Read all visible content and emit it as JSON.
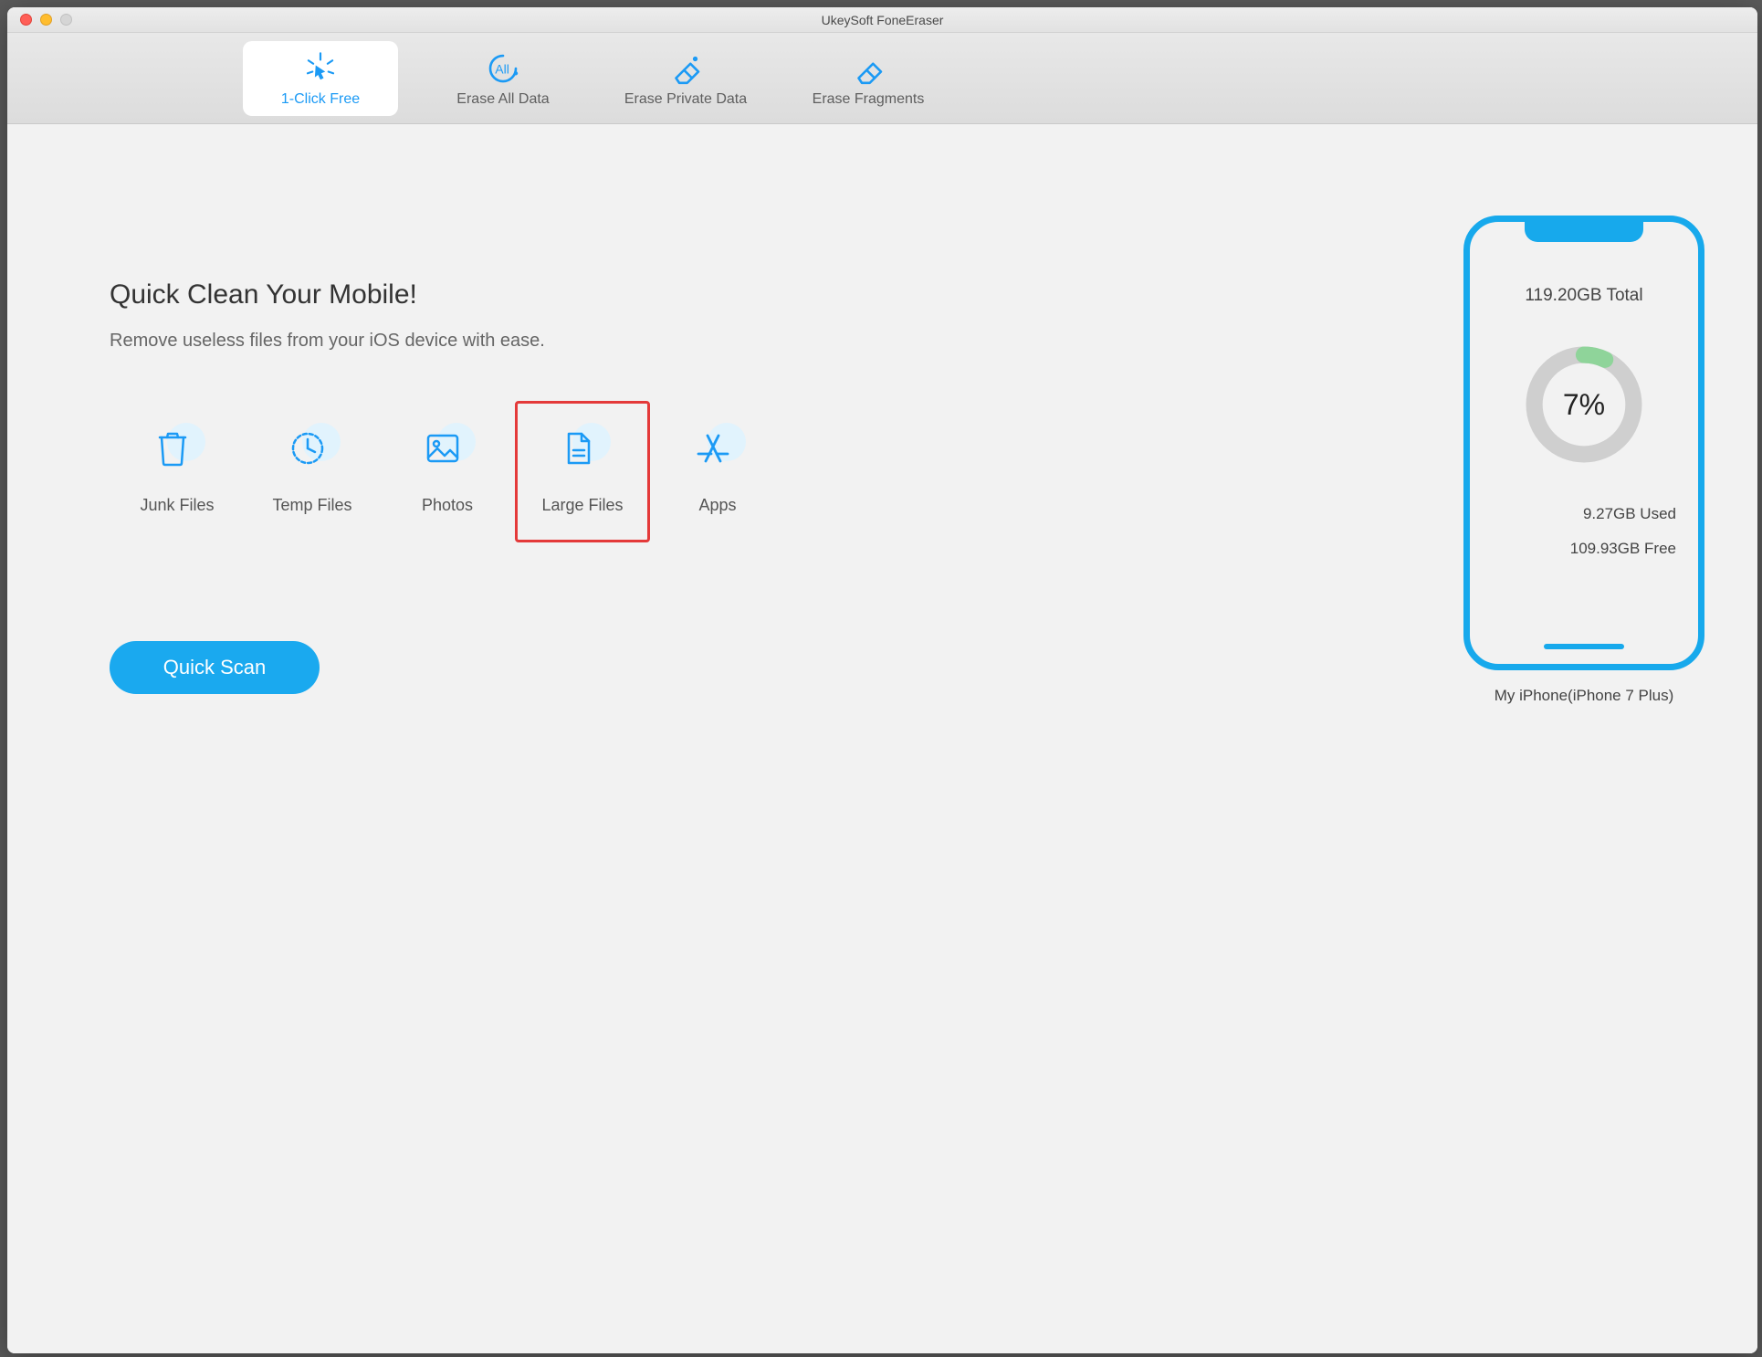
{
  "window": {
    "title": "UkeySoft FoneEraser"
  },
  "tabs": [
    {
      "label": "1-Click Free",
      "icon": "click-cursor-icon",
      "active": true
    },
    {
      "label": "Erase All Data",
      "icon": "erase-all-icon",
      "active": false
    },
    {
      "label": "Erase Private Data",
      "icon": "eraser-private-icon",
      "active": false
    },
    {
      "label": "Erase Fragments",
      "icon": "eraser-fragments-icon",
      "active": false
    }
  ],
  "main": {
    "heading": "Quick Clean Your Mobile!",
    "subheading": "Remove useless files from your iOS device with ease.",
    "categories": [
      {
        "label": "Junk Files",
        "icon": "trash-icon",
        "highlighted": false
      },
      {
        "label": "Temp Files",
        "icon": "clock-icon",
        "highlighted": false
      },
      {
        "label": "Photos",
        "icon": "photo-icon",
        "highlighted": false
      },
      {
        "label": "Large Files",
        "icon": "file-icon",
        "highlighted": true
      },
      {
        "label": "Apps",
        "icon": "appstore-icon",
        "highlighted": false
      }
    ],
    "scan_button": "Quick Scan"
  },
  "device": {
    "total_label": "119.20GB Total",
    "used_percent": 7,
    "percent_label": "7%",
    "used_label": "9.27GB Used",
    "free_label": "109.93GB Free",
    "name": "My iPhone(iPhone 7 Plus)"
  },
  "colors": {
    "accent": "#17a9ec",
    "highlight_border": "#e43a3a",
    "donut_bg": "#cfcfcf",
    "donut_fg": "#8fd49a"
  }
}
